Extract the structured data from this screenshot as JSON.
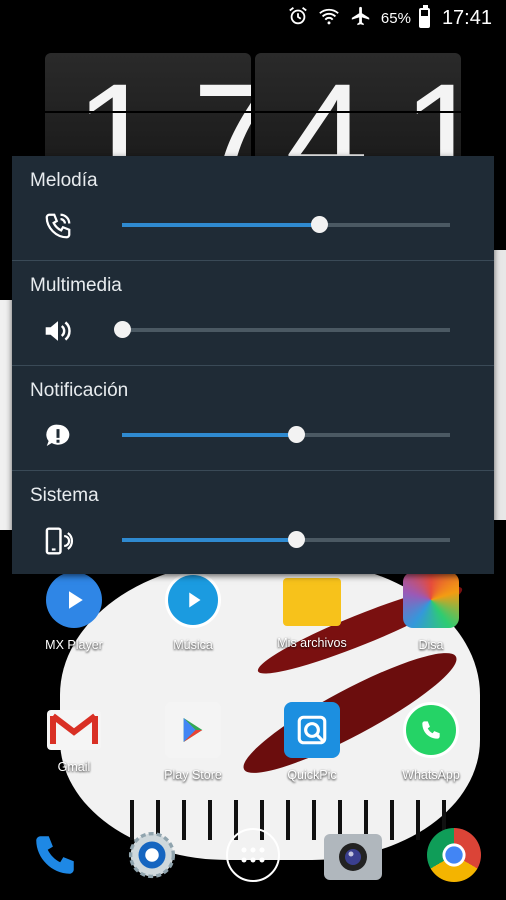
{
  "status_bar": {
    "battery_percent_label": "65%",
    "battery_level": 0.65,
    "time": "17:41",
    "icons": [
      "alarm-icon",
      "wifi-icon",
      "airplane-mode-icon",
      "battery-icon"
    ]
  },
  "clock_widget": {
    "hours": "17",
    "minutes": "41"
  },
  "volume_panel": {
    "accent_color": "#2f8ad0",
    "rows": [
      {
        "label": "Melodía",
        "icon": "ringtone-icon",
        "level": 0.6
      },
      {
        "label": "Multimedia",
        "icon": "speaker-icon",
        "level": 0.0
      },
      {
        "label": "Notificación",
        "icon": "notification-icon",
        "level": 0.53
      },
      {
        "label": "Sistema",
        "icon": "vibrate-phone-icon",
        "level": 0.53
      }
    ]
  },
  "apps": {
    "row1": [
      {
        "label": "MX Player",
        "icon": "mx-player-icon"
      },
      {
        "label": "Música",
        "icon": "music-icon"
      },
      {
        "label": "Mis archivos",
        "icon": "folder-icon"
      },
      {
        "label": "Disa",
        "icon": "disa-icon"
      }
    ],
    "row2": [
      {
        "label": "Gmail",
        "icon": "gmail-icon"
      },
      {
        "label": "Play Store",
        "icon": "play-store-icon"
      },
      {
        "label": "QuickPic",
        "icon": "quickpic-icon"
      },
      {
        "label": "WhatsApp",
        "icon": "whatsapp-icon"
      }
    ]
  },
  "dock": {
    "items": [
      "phone-icon",
      "settings-icon",
      "app-drawer-icon",
      "camera-icon",
      "chrome-icon"
    ]
  }
}
